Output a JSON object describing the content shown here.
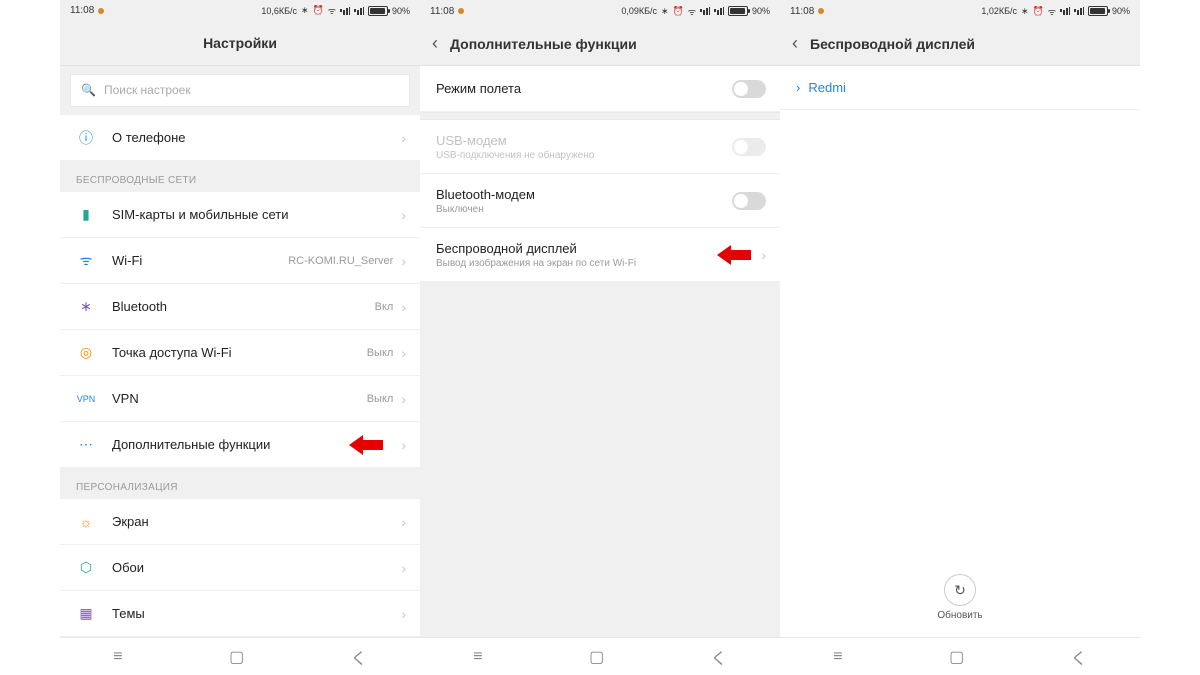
{
  "status": {
    "time": "11:08",
    "battery_pct": "90%",
    "icons": [
      "bluetooth",
      "alarm",
      "wifi",
      "signal",
      "signal"
    ]
  },
  "screen1": {
    "data_rate": "10,6КБ/с",
    "title": "Настройки",
    "search_placeholder": "Поиск настроек",
    "about_label": "О телефоне",
    "section_wireless": "БЕСПРОВОДНЫЕ СЕТИ",
    "rows": {
      "sim": "SIM-карты и мобильные сети",
      "wifi": "Wi-Fi",
      "wifi_value": "RC-KOMI.RU_Server",
      "bt": "Bluetooth",
      "bt_value": "Вкл",
      "hotspot": "Точка доступа Wi-Fi",
      "hotspot_value": "Выкл",
      "vpn": "VPN",
      "vpn_value": "Выкл",
      "more": "Дополнительные функции"
    },
    "section_personal": "ПЕРСОНАЛИЗАЦИЯ",
    "rows2": {
      "display": "Экран",
      "wallpaper": "Обои",
      "themes": "Темы"
    }
  },
  "screen2": {
    "data_rate": "0,09КБ/с",
    "title": "Дополнительные функции",
    "rows": {
      "airplane": "Режим полета",
      "usb": "USB-модем",
      "usb_sub": "USB-подключения не обнаружено",
      "btmodem": "Bluetooth-модем",
      "btmodem_sub": "Выключен",
      "cast": "Беспроводной дисплей",
      "cast_sub": "Вывод изображения на экран по сети Wi-Fi"
    }
  },
  "screen3": {
    "data_rate": "1,02КБ/с",
    "title": "Беспроводной дисплей",
    "device": "Redmi",
    "refresh": "Обновить"
  }
}
